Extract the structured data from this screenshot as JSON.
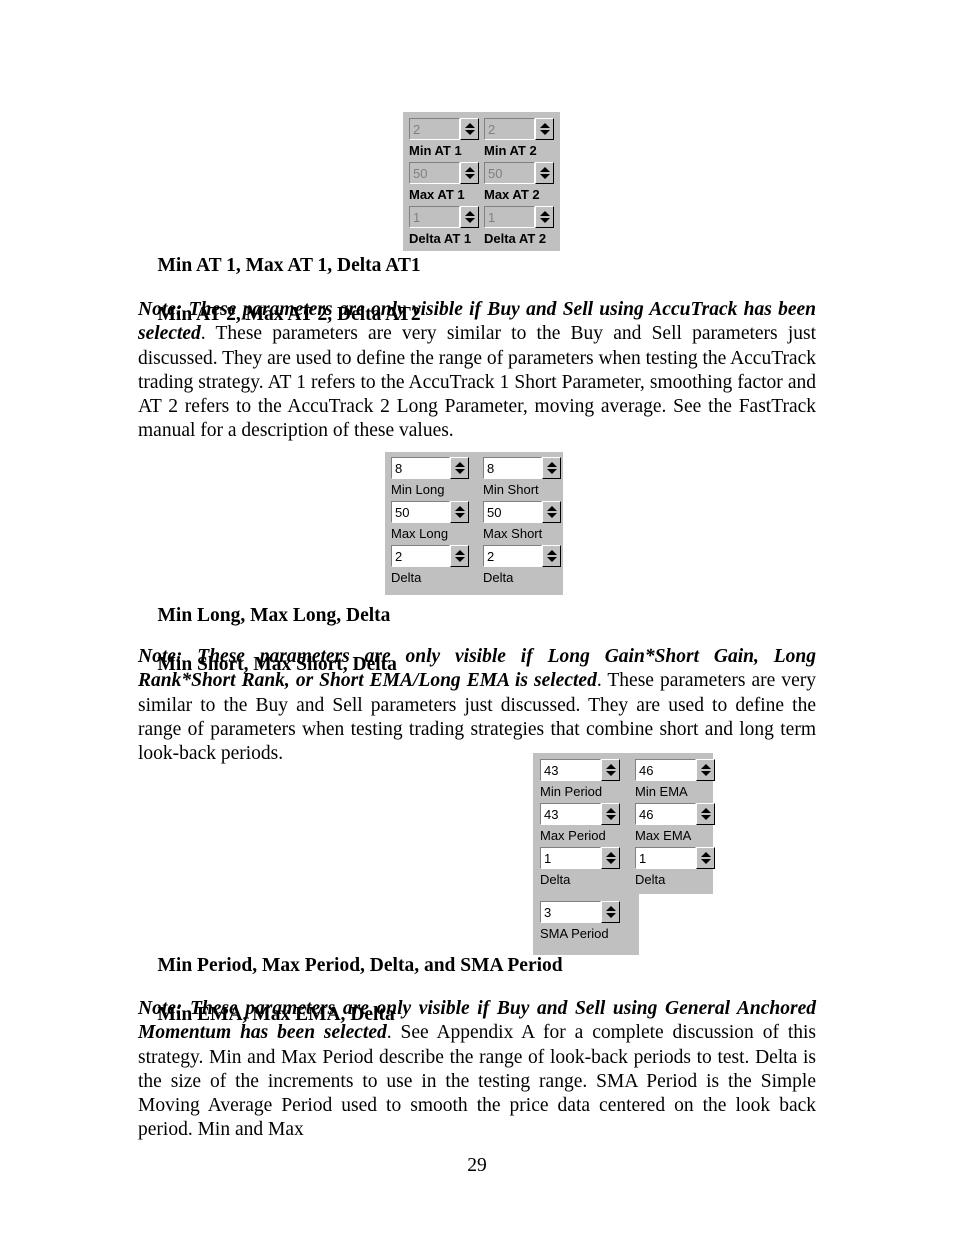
{
  "document": {
    "page_number": "29",
    "headings": [
      {
        "line1": "Min AT 1, Max AT 1, Delta AT1",
        "line2": "Min AT 2, Max AT 2, Delta AT2"
      },
      {
        "line1": "Min Long, Max Long, Delta",
        "line2": "Min Short, Max Short, Delta"
      },
      {
        "line1": "Min Period, Max Period, Delta, and SMA Period",
        "line2": "Min EMA, Max EMA, Delta"
      }
    ],
    "paragraphs": [
      {
        "emphasis": "Note: These parameters are only visible if Buy and Sell using AccuTrack has been selected",
        "body": ". These parameters are very similar to the Buy and Sell parameters just discussed. They are used to define the range of parameters when testing the AccuTrack trading strategy.  AT 1 refers to the AccuTrack 1 Short Parameter, smoothing factor and AT 2 refers to the AccuTrack 2 Long Parameter, moving average.  See the FastTrack manual for a description of these values."
      },
      {
        "emphasis": "Note: These parameters are only visible if Long Gain*Short Gain, Long Rank*Short Rank, or Short EMA/Long EMA is selected",
        "body": ". These parameters are very similar to the Buy and Sell parameters just discussed.  They are used to define the range of parameters when testing trading strategies that combine short and long term look-back periods."
      },
      {
        "emphasis": "Note: These parameters are only visible if Buy and Sell using General Anchored Momentum has been selected",
        "body": ". See Appendix A for a complete discussion of this strategy. Min and Max Period describe the range of look-back periods to test.  Delta is the size of the increments to use in the testing range.  SMA Period is the Simple Moving Average Period used to smooth the price data centered on the look back period.  Min and Max"
      }
    ]
  },
  "widgets": {
    "accutrack_panel": {
      "name": "AccuTrack parameters panel",
      "disabled": true,
      "columns": [
        {
          "fields": [
            {
              "value": "2",
              "label": "Min AT 1",
              "spinner": "spinner-up-down"
            },
            {
              "value": "50",
              "label": "Max AT 1",
              "spinner": "spinner-up-down"
            },
            {
              "value": "1",
              "label": "Delta AT 1",
              "spinner": "spinner-up-down"
            }
          ]
        },
        {
          "fields": [
            {
              "value": "2",
              "label": "Min AT 2",
              "spinner": "spinner-up-down"
            },
            {
              "value": "50",
              "label": "Max AT 2",
              "spinner": "spinner-up-down"
            },
            {
              "value": "1",
              "label": "Delta AT 2",
              "spinner": "spinner-up-down"
            }
          ]
        }
      ]
    },
    "longshort_panel": {
      "name": "Long and Short parameters panel",
      "disabled": false,
      "columns": [
        {
          "fields": [
            {
              "value": "8",
              "label": "Min Long",
              "spinner": "spinner-up-down"
            },
            {
              "value": "50",
              "label": "Max Long",
              "spinner": "spinner-up-down"
            },
            {
              "value": "2",
              "label": "Delta",
              "spinner": "spinner-up-down"
            }
          ]
        },
        {
          "fields": [
            {
              "value": "8",
              "label": "Min Short",
              "spinner": "spinner-up-down"
            },
            {
              "value": "50",
              "label": "Max Short",
              "spinner": "spinner-up-down"
            },
            {
              "value": "2",
              "label": "Delta",
              "spinner": "spinner-up-down"
            }
          ]
        }
      ]
    },
    "anchored_momentum_panel": {
      "name": "General Anchored Momentum parameters panel",
      "disabled": false,
      "columns": [
        {
          "fields": [
            {
              "value": "43",
              "label": "Min Period",
              "spinner": "spinner-up-down"
            },
            {
              "value": "43",
              "label": "Max Period",
              "spinner": "spinner-up-down"
            },
            {
              "value": "1",
              "label": "Delta",
              "spinner": "spinner-up-down"
            },
            {
              "value": "3",
              "label": "SMA Period",
              "spinner": "spinner-up-down"
            }
          ]
        },
        {
          "fields": [
            {
              "value": "46",
              "label": "Min EMA",
              "spinner": "spinner-up-down"
            },
            {
              "value": "46",
              "label": "Max EMA",
              "spinner": "spinner-up-down"
            },
            {
              "value": "1",
              "label": "Delta",
              "spinner": "spinner-up-down"
            }
          ]
        }
      ]
    }
  }
}
